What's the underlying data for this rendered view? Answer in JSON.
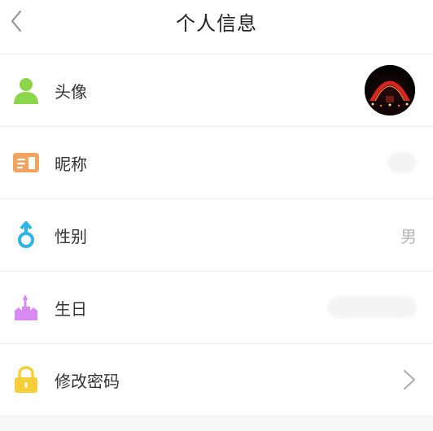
{
  "header": {
    "title": "个人信息",
    "back_icon": "chevron-left-icon"
  },
  "rows": [
    {
      "label": "头像",
      "icon": "person-icon",
      "icon_color": "#8BD64A",
      "right": "avatar-image"
    },
    {
      "label": "昵称",
      "icon": "id-card-icon",
      "icon_color": "#F4A35E",
      "right": "blurred-text"
    },
    {
      "label": "性别",
      "icon": "gender-icon",
      "icon_color": "#2DB4E8",
      "value": "男"
    },
    {
      "label": "生日",
      "icon": "cake-icon",
      "icon_color": "#D98AF0",
      "right": "blurred-text"
    },
    {
      "label": "修改密码",
      "icon": "lock-icon",
      "icon_color": "#F6CE3A",
      "right": "chevron-right-icon"
    }
  ]
}
